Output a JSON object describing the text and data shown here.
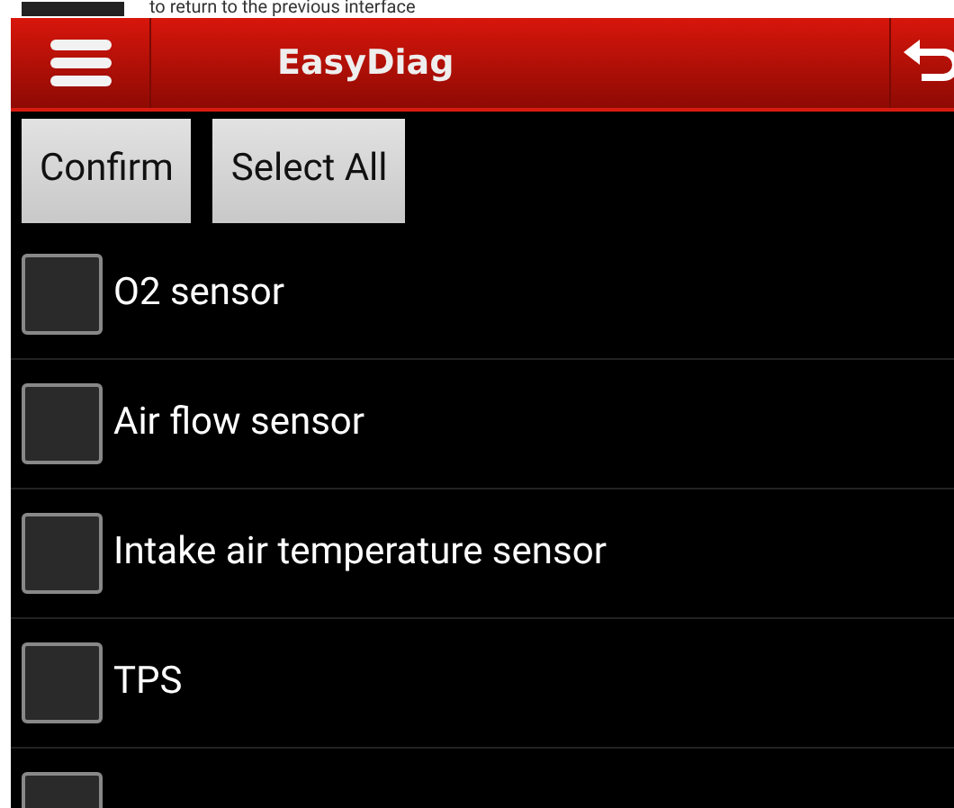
{
  "caption": {
    "text": "to return to the previous interface"
  },
  "header": {
    "title": "EasyDiag"
  },
  "buttons": [
    "Confirm",
    "Select All"
  ],
  "items": [
    {
      "label": "O2 sensor",
      "checked": false
    },
    {
      "label": "Air flow sensor",
      "checked": false
    },
    {
      "label": "Intake air temperature sensor",
      "checked": false
    },
    {
      "label": "TPS",
      "checked": false
    },
    {
      "checked": false
    }
  ]
}
